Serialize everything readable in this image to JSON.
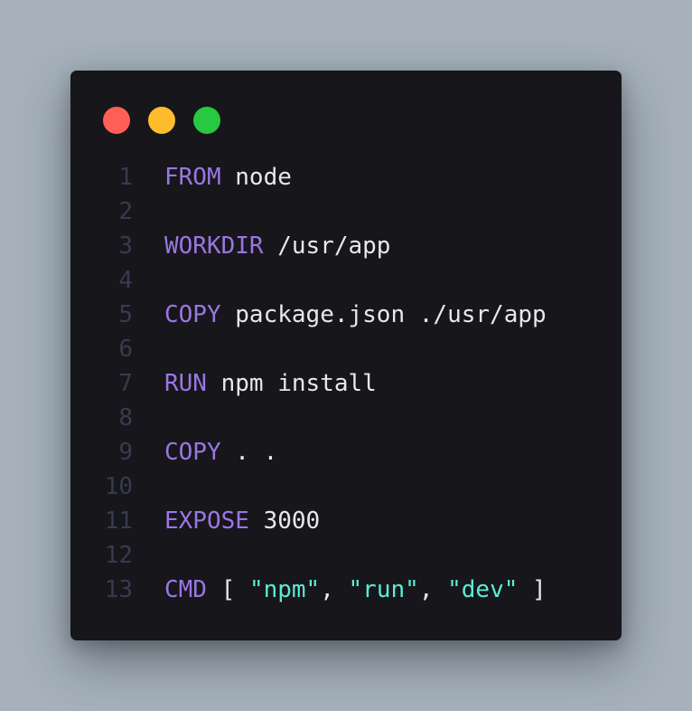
{
  "window": {
    "traffic_lights": [
      {
        "name": "close",
        "color": "#ff5f57"
      },
      {
        "name": "minimize",
        "color": "#ffbd2e"
      },
      {
        "name": "maximize",
        "color": "#28c840"
      }
    ]
  },
  "theme": {
    "background": "#16161b",
    "keyword_color": "#9a76e2",
    "string_color": "#5eead4",
    "text_color": "#e8e8ec",
    "line_number_color": "#373b4c"
  },
  "code": {
    "language": "Dockerfile",
    "lines": [
      {
        "number": "1",
        "keyword": "FROM",
        "rest": " node"
      },
      {
        "number": "2",
        "keyword": "",
        "rest": ""
      },
      {
        "number": "3",
        "keyword": "WORKDIR",
        "rest": " /usr/app"
      },
      {
        "number": "4",
        "keyword": "",
        "rest": ""
      },
      {
        "number": "5",
        "keyword": "COPY",
        "rest": " package.json ./usr/app"
      },
      {
        "number": "6",
        "keyword": "",
        "rest": ""
      },
      {
        "number": "7",
        "keyword": "RUN",
        "rest": " npm install"
      },
      {
        "number": "8",
        "keyword": "",
        "rest": ""
      },
      {
        "number": "9",
        "keyword": "COPY",
        "rest": " . ."
      },
      {
        "number": "10",
        "keyword": "",
        "rest": ""
      },
      {
        "number": "11",
        "keyword": "EXPOSE",
        "rest": " 3000"
      },
      {
        "number": "12",
        "keyword": "",
        "rest": ""
      },
      {
        "number": "13",
        "keyword": "CMD",
        "cmd": {
          "open": " [ ",
          "s1": "\"npm\"",
          "sep1": ", ",
          "s2": "\"run\"",
          "sep2": ", ",
          "s3": "\"dev\"",
          "close": " ]"
        }
      }
    ]
  }
}
